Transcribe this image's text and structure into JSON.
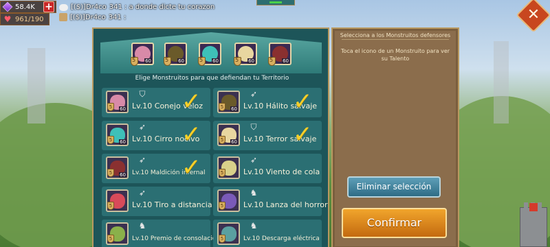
{
  "hud": {
    "gems": "58.4K",
    "stamina": "961/190",
    "add_label": "+"
  },
  "chat": [
    {
      "sender": "[($)]Dr4co",
      "text": "341 : a donde dicte tu corazon"
    },
    {
      "sender": "[($)]Dr4co",
      "text": "341 :"
    }
  ],
  "close_label": "✕",
  "panel": {
    "subtitle": "Elige Monstruitos para que defiendan tu Territorio",
    "defenders": [
      {
        "level": "60",
        "color": "#d88aa8"
      },
      {
        "level": "60",
        "color": "#6a5a2a"
      },
      {
        "level": "60",
        "color": "#3ec0b8"
      },
      {
        "level": "60",
        "color": "#e8d6a0"
      },
      {
        "level": "60",
        "color": "#8a3030"
      }
    ],
    "monsters": [
      {
        "name": "Lv.10 Conejo veloz",
        "level": "60",
        "stars": "5",
        "type_icon": "shield-icon",
        "selected": true,
        "color": "#d88aa8"
      },
      {
        "name": "Lv.10 Hálito salvaje",
        "level": "60",
        "stars": "5",
        "type_icon": "bow-icon",
        "selected": true,
        "color": "#6a5a2a"
      },
      {
        "name": "Lv.10 Cirro nocivo",
        "level": "60",
        "stars": "5",
        "type_icon": "bow-icon",
        "selected": true,
        "color": "#3ec0b8"
      },
      {
        "name": "Lv.10 Terror salvaje",
        "level": "60",
        "stars": "5",
        "type_icon": "shield-icon",
        "selected": true,
        "color": "#e8d6a0"
      },
      {
        "name": "Lv.10 Maldición infernal",
        "level": "60",
        "stars": "5",
        "type_icon": "bow-icon",
        "selected": true,
        "color": "#8a3030"
      },
      {
        "name": "Lv.10 Viento de cola",
        "level": "",
        "stars": "5",
        "type_icon": "bow-icon",
        "selected": false,
        "color": "#d8d08a"
      },
      {
        "name": "Lv.10 Tiro a distancia",
        "level": "",
        "stars": "5",
        "type_icon": "bow-icon",
        "selected": false,
        "color": "#d84a5a"
      },
      {
        "name": "Lv.10 Lanza del horror",
        "level": "",
        "stars": "5",
        "type_icon": "horse-icon",
        "selected": false,
        "color": "#7a5ab8"
      },
      {
        "name": "Lv.10 Premio de consolación",
        "level": "",
        "stars": "5",
        "type_icon": "horse-icon",
        "selected": false,
        "color": "#8ab04a"
      },
      {
        "name": "Lv.10 Descarga eléctrica",
        "level": "",
        "stars": "5",
        "type_icon": "horse-icon",
        "selected": false,
        "color": "#5aa0a0"
      }
    ]
  },
  "side": {
    "title": "Selecciona a los Monstruitos defensores",
    "description": "Toca el icono de un Monstruito para ver su Talento",
    "clear_label": "Eliminar selección",
    "confirm_label": "Confirmar"
  }
}
